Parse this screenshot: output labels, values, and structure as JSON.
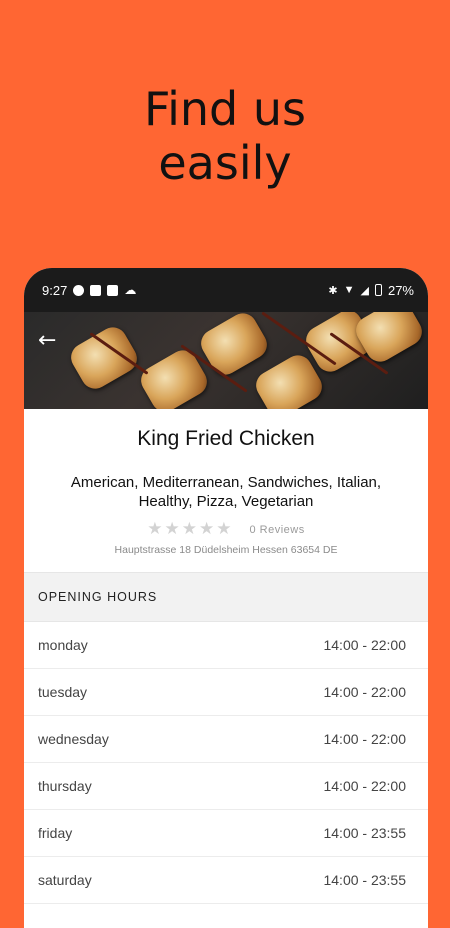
{
  "headline": {
    "line1": "Find us",
    "line2": "easily"
  },
  "status_bar": {
    "time": "9:27",
    "battery": "27%"
  },
  "restaurant": {
    "name": "King Fried Chicken",
    "cuisines": "American, Mediterranean, Sandwiches, Italian, Healthy, Pizza, Vegetarian",
    "rating": {
      "stars": 0,
      "max_stars": 5,
      "reviews": "0 Reviews"
    },
    "address": "Hauptstrasse 18 Düdelsheim Hessen 63654 DE"
  },
  "opening_hours": {
    "title": "OPENING HOURS",
    "days": [
      {
        "day": "monday",
        "hours": "14:00 - 22:00"
      },
      {
        "day": "tuesday",
        "hours": "14:00 - 22:00"
      },
      {
        "day": "wednesday",
        "hours": "14:00 - 22:00"
      },
      {
        "day": "thursday",
        "hours": "14:00 - 22:00"
      },
      {
        "day": "friday",
        "hours": "14:00 - 23:55"
      },
      {
        "day": "saturday",
        "hours": "14:00 - 23:55"
      }
    ]
  },
  "colors": {
    "background": "#FF6633",
    "status_bar": "#1B1B1B",
    "section_header": "#F2F2F2"
  }
}
